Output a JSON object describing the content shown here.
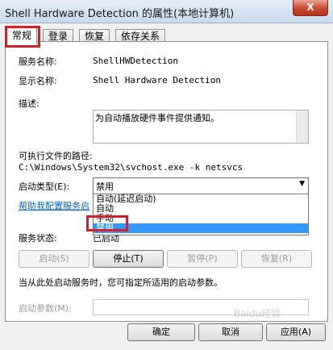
{
  "window": {
    "title": "Shell Hardware Detection 的属性(本地计算机)",
    "close_label": "X"
  },
  "tabs": [
    {
      "label": "常规",
      "active": true
    },
    {
      "label": "登录",
      "active": false
    },
    {
      "label": "恢复",
      "active": false
    },
    {
      "label": "依存关系",
      "active": false
    }
  ],
  "general": {
    "service_name_label": "服务名称:",
    "service_name_value": "ShellHWDetection",
    "display_name_label": "显示名称:",
    "display_name_value": "Shell Hardware Detection",
    "description_label": "描述:",
    "description_value": "为自动播放硬件事件提供通知。",
    "exe_path_label": "可执行文件的路径:",
    "exe_path_value": "C:\\Windows\\System32\\svchost.exe -k netsvcs",
    "startup_type_label": "启动类型(E):",
    "startup_type_value": "禁用",
    "startup_options": [
      "自动(延迟启动)",
      "自动",
      "手动",
      "禁用"
    ],
    "help_link": "帮助我配置服务启",
    "service_status_label": "服务状态:",
    "service_status_value": "已启动",
    "start_button": "启动(S)",
    "stop_button": "停止(T)",
    "pause_button": "暂停(P)",
    "resume_button": "恢复(R)",
    "start_hint": "当从此处启动服务时，您可指定所适用的启动参数。",
    "start_params_label": "启动参数(M):",
    "start_params_value": ""
  },
  "footer": {
    "ok_button": "确定",
    "cancel_button": "取消",
    "apply_button": "应用(A)"
  },
  "watermark": "Baidu经验"
}
